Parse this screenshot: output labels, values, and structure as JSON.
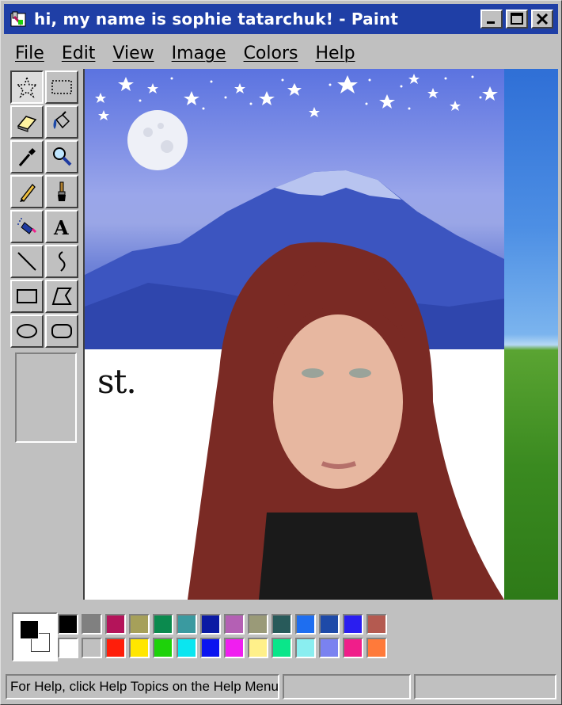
{
  "window": {
    "title": "hi, my name is sophie tatarchuk! - Paint"
  },
  "title_buttons": [
    "minimize",
    "maximize",
    "close"
  ],
  "menu": [
    "File",
    "Edit",
    "View",
    "Image",
    "Colors",
    "Help"
  ],
  "tools": [
    "free-form-select",
    "select",
    "eraser",
    "fill-with-color",
    "pick-color",
    "magnifier",
    "pencil",
    "brush",
    "airbrush",
    "text",
    "line",
    "curve",
    "rectangle",
    "polygon",
    "ellipse",
    "rounded-rectangle"
  ],
  "canvas": {
    "text": "st.",
    "scene": "night-sky-mountain-with-moon-and-portrait"
  },
  "colors": {
    "foreground": "#000000",
    "background": "#ffffff",
    "palette_row1": [
      "#000000",
      "#808080",
      "#b4145a",
      "#a6a05a",
      "#0b8a4e",
      "#3a9aa0",
      "#0b1aa4",
      "#b460b4",
      "#9a9a78",
      "#285a5a",
      "#1e6ef0",
      "#1e4aa8",
      "#2a1ef0",
      "#b45a50"
    ],
    "palette_row2": [
      "#ffffff",
      "#c0c0c0",
      "#ff1e0a",
      "#ffe600",
      "#1ed20a",
      "#0ae6f0",
      "#0a14f0",
      "#f01ef0",
      "#fff08a",
      "#0ae68a",
      "#8aeef0",
      "#7a82f0",
      "#f01e8a",
      "#ff7a3a"
    ]
  },
  "status": {
    "help": "For Help, click Help Topics on the Help Menu.",
    "coords": "",
    "size": ""
  }
}
